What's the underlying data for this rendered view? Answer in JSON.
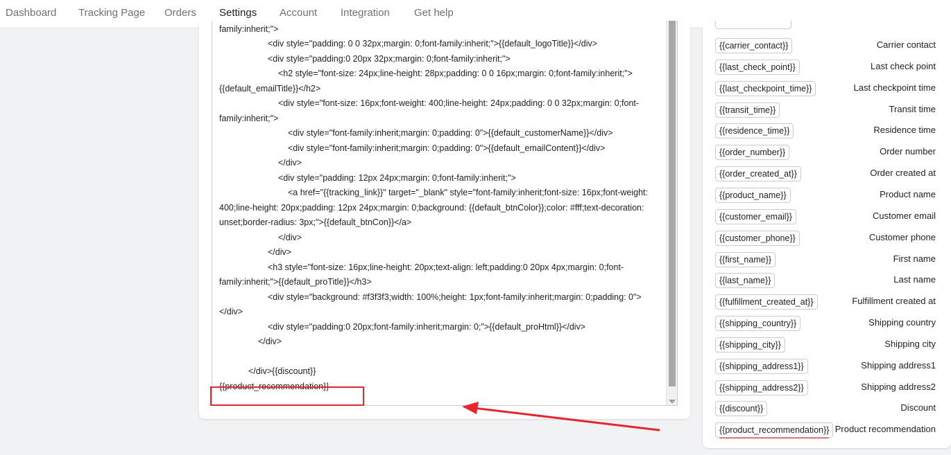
{
  "nav": {
    "tabs": [
      {
        "label": "Dashboard"
      },
      {
        "label": "Tracking Page"
      },
      {
        "label": "Orders"
      },
      {
        "label": "Settings"
      },
      {
        "label": "Account"
      },
      {
        "label": "Integration"
      },
      {
        "label": "Get help"
      }
    ],
    "active": "Settings"
  },
  "editor": {
    "lines": [
      "family:inherit;\">",
      "<div style=\"padding: 0 0 32px;margin: 0;font-family:inherit;\">{{default_logoTitle}}</div>",
      "<div style=\"padding:0 20px 32px;margin: 0;font-family:inherit;\">",
      "<h2 style=\"font-size: 24px;line-height: 28px;padding: 0 0 16px;margin: 0;font-family:inherit;\">",
      "{{default_emailTitle}}</h2>",
      "<div style=\"font-size: 16px;font-weight: 400;line-height: 24px;padding: 0 0 32px;margin: 0;font-",
      "family:inherit;\">",
      "<div style=\"font-family:inherit;margin: 0;padding: 0\">{{default_customerName}}</div>",
      "<div style=\"font-family:inherit;margin: 0;padding: 0\">{{default_emailContent}}</div>",
      "</div>",
      "<div style=\"padding: 12px 24px;margin: 0;font-family:inherit;\">",
      "<a href=\"{{tracking_link}}\" target=\"_blank\" style=\"font-family:inherit;font-size: 16px;font-weight:",
      "400;line-height: 20px;padding: 12px 24px;margin: 0;background: {{default_btnColor}};color: #fff;text-decoration:",
      "unset;border-radius: 3px;\">{{default_btnCon}}</a>",
      "</div>",
      "</div>",
      "<h3 style=\"font-size: 16px;line-height: 20px;text-align: left;padding:0 20px 4px;margin: 0;font-",
      "family:inherit;\">{{default_proTitle}}</h3>",
      "<div style=\"background: #f3f3f3;width: 100%;height: 1px;font-family:inherit;margin: 0;padding: 0\">",
      "</div>",
      "<div style=\"padding:0 20px;font-family:inherit;margin: 0;\">{{default_proHtml}}</div>",
      "</div>",
      "",
      "</div>{{discount}}",
      "{{product_recommendation}}"
    ]
  },
  "variables": [
    {
      "tag": "{{carrier_contact}}",
      "label": "Carrier contact"
    },
    {
      "tag": "{{last_check_point}}",
      "label": "Last check point"
    },
    {
      "tag": "{{last_checkpoint_time}}",
      "label": "Last checkpoint time"
    },
    {
      "tag": "{{transit_time}}",
      "label": "Transit time"
    },
    {
      "tag": "{{residence_time}}",
      "label": "Residence time"
    },
    {
      "tag": "{{order_number}}",
      "label": "Order number"
    },
    {
      "tag": "{{order_created_at}}",
      "label": "Order created at"
    },
    {
      "tag": "{{product_name}}",
      "label": "Product name"
    },
    {
      "tag": "{{customer_email}}",
      "label": "Customer email"
    },
    {
      "tag": "{{customer_phone}}",
      "label": "Customer phone"
    },
    {
      "tag": "{{first_name}}",
      "label": "First name"
    },
    {
      "tag": "{{last_name}}",
      "label": "Last name"
    },
    {
      "tag": "{{fulfillment_created_at}}",
      "label": "Fulfillment created at"
    },
    {
      "tag": "{{shipping_country}}",
      "label": "Shipping country"
    },
    {
      "tag": "{{shipping_city}}",
      "label": "Shipping city"
    },
    {
      "tag": "{{shipping_address1}}",
      "label": "Shipping address1"
    },
    {
      "tag": "{{shipping_address2}}",
      "label": "Shipping address2"
    },
    {
      "tag": "{{discount}}",
      "label": "Discount"
    },
    {
      "tag": "{{product_recommendation}}",
      "label": "Product recommendation"
    }
  ],
  "colors": {
    "accent": "#008060",
    "annotation": "#e5262d"
  }
}
